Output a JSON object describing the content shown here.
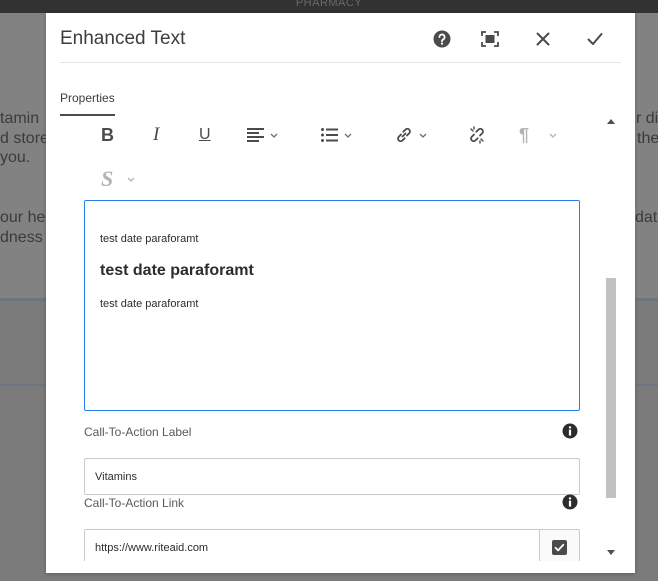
{
  "background": {
    "topbar_text": "PHARMACY",
    "fragments": [
      "tamin",
      "d store",
      "you.",
      "our he",
      "dness",
      "r di",
      "the",
      "dat"
    ]
  },
  "dialog": {
    "title": "Enhanced Text",
    "header_actions": [
      {
        "name": "help-icon",
        "label": "Help"
      },
      {
        "name": "fullscreen-icon",
        "label": "Fullscreen"
      },
      {
        "name": "close-icon",
        "label": "Cancel"
      },
      {
        "name": "checkmark-icon",
        "label": "Done"
      }
    ],
    "tabs": [
      {
        "label": "Properties",
        "active": true
      }
    ]
  },
  "toolbar": {
    "bold": "B",
    "italic": "I",
    "underline": "U",
    "paragraph": "¶",
    "styles": "S"
  },
  "editor": {
    "paragraph_1": "test date paraforamt",
    "heading": "test date paraforamt",
    "paragraph_2": "test date paraforamt"
  },
  "cta_label": {
    "label": "Call-To-Action Label",
    "value": "Vitamins"
  },
  "cta_link": {
    "label": "Call-To-Action Link",
    "value": "https://www.riteaid.com",
    "checked": true
  },
  "colors": {
    "accent_border": "#2680eb",
    "icon": "#4b4b4b",
    "text": "#3d3d3d"
  }
}
